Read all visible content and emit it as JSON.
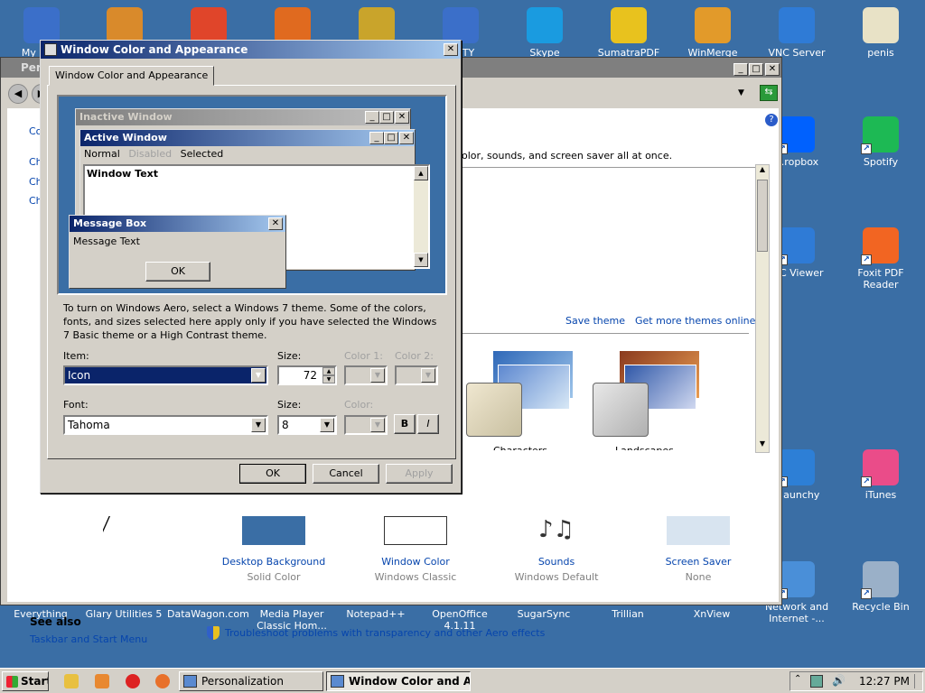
{
  "desktop": {
    "top_icons": [
      {
        "label": "My Co...",
        "color": "#3b6fc9"
      },
      {
        "label": "",
        "color": "#d98a2b"
      },
      {
        "label": "",
        "color": "#e0452a"
      },
      {
        "label": "",
        "color": "#e06a1f"
      },
      {
        "label": "",
        "color": "#c9a42b"
      },
      {
        "label": "...TTY",
        "color": "#3b6fc9"
      },
      {
        "label": "Skype",
        "color": "#1a9be0"
      },
      {
        "label": "SumatraPDF",
        "color": "#e8c21e"
      },
      {
        "label": "WinMerge",
        "color": "#e29a2a"
      },
      {
        "label": "VNC Server",
        "color": "#2f7bd6"
      },
      {
        "label": "penis",
        "color": "#e8e2c6"
      }
    ],
    "right_icons": [
      {
        "label": "...ropbox",
        "color": "#0061fe"
      },
      {
        "label": "Spotify",
        "color": "#1db954"
      },
      {
        "label": "...C Viewer",
        "color": "#2f7bd6"
      },
      {
        "label": "Foxit PDF Reader",
        "color": "#f26522"
      },
      {
        "label": "...aunchy",
        "color": "#2d7fd6"
      },
      {
        "label": "iTunes",
        "color": "#ea4c89"
      },
      {
        "label": "Network and Internet -...",
        "color": "#4a8fd8"
      },
      {
        "label": "Recycle Bin",
        "color": "#9ab0c8"
      }
    ],
    "bottom_icons": [
      "Everything",
      "Glary Utilities 5",
      "DataWagon.com",
      "Media Player Classic Hom...",
      "Notepad++",
      "OpenOffice 4.1.11",
      "SugarSync",
      "Trillian",
      "XnView"
    ]
  },
  "personalization": {
    "title": "Pers...",
    "left_links": [
      "Co...",
      "Ch...",
      "Ch...",
      "Ch..."
    ],
    "description": "olor, sounds, and screen saver all at once.",
    "save_theme": "Save theme",
    "get_more": "Get more themes online",
    "themes": [
      {
        "name": "Characters"
      },
      {
        "name": "Landscapes"
      }
    ],
    "bottom_items": [
      {
        "title": "Desktop Background",
        "sub": "Solid Color"
      },
      {
        "title": "Window Color",
        "sub": "Windows Classic"
      },
      {
        "title": "Sounds",
        "sub": "Windows Default"
      },
      {
        "title": "Screen Saver",
        "sub": "None"
      }
    ],
    "see_also": "See also",
    "taskbar_link": "Taskbar and Start Menu",
    "troubleshoot": "Troubleshoot problems with transparency and other Aero effects"
  },
  "dialog": {
    "title": "Window Color and Appearance",
    "tab": "Window Color and Appearance",
    "preview": {
      "inactive": "Inactive Window",
      "active": "Active Window",
      "menu_normal": "Normal",
      "menu_disabled": "Disabled",
      "menu_selected": "Selected",
      "window_text": "Window Text",
      "msgbox_title": "Message Box",
      "msgbox_text": "Message Text",
      "ok": "OK"
    },
    "info": "To turn on Windows Aero, select a Windows 7 theme.  Some of the colors, fonts, and sizes selected here apply only if you have selected the Windows 7 Basic theme or a High Contrast theme.",
    "item_label": "Item:",
    "item_value": "Icon",
    "size_label": "Size:",
    "size_value": "72",
    "color1_label": "Color 1:",
    "color2_label": "Color 2:",
    "font_label": "Font:",
    "font_value": "Tahoma",
    "font_size_label": "Size:",
    "font_size_value": "8",
    "font_color_label": "Color:",
    "bold": "B",
    "italic": "I",
    "ok": "OK",
    "cancel": "Cancel",
    "apply": "Apply"
  },
  "taskbar": {
    "start": "Start",
    "tasks": [
      "Personalization",
      "Window Color and Ap..."
    ],
    "time": "12:27 PM"
  }
}
